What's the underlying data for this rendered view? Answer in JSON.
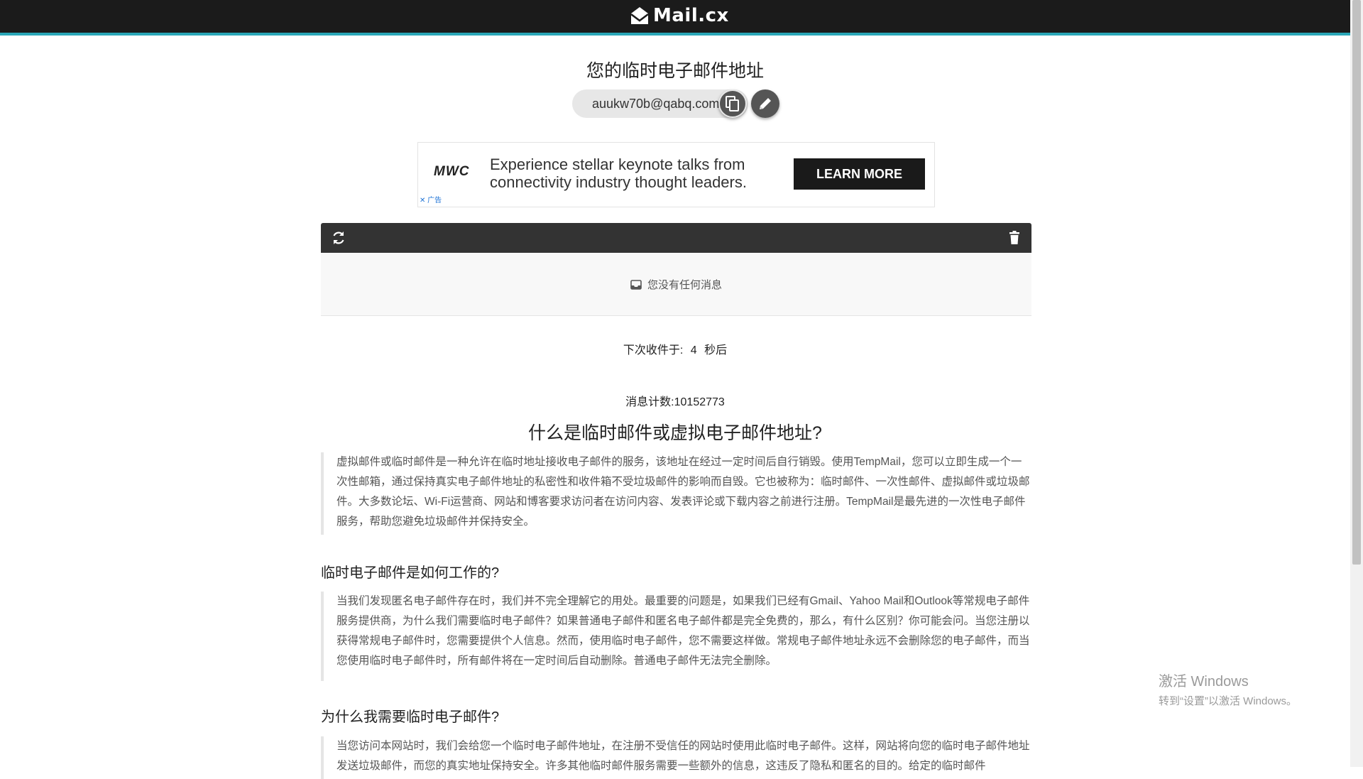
{
  "header": {
    "logo_text": "Mail.cx"
  },
  "main": {
    "title": "您的临时电子邮件地址",
    "email_address": "auukw70b@qabq.com"
  },
  "ad": {
    "brand": "MWC",
    "copy": "Experience stellar keynote talks from connectivity industry thought leaders.",
    "cta": "LEARN MORE",
    "tag": "✕ 广告"
  },
  "inbox": {
    "empty_message": "您没有任何消息",
    "countdown_prefix": "下次收件于:",
    "countdown_value": "4",
    "countdown_suffix": "秒后",
    "message_count": "消息计数:10152773"
  },
  "article": {
    "heading": "什么是临时邮件或虚拟电子邮件地址?",
    "intro": "虚拟邮件或临时邮件是一种允许在临时地址接收电子邮件的服务，该地址在经过一定时间后自行销毁。使用TempMail，您可以立即生成一个一次性邮箱，通过保持真实电子邮件地址的私密性和收件箱不受垃圾邮件的影响而自毁。它也被称为：临时邮件、一次性邮件、虚拟邮件或垃圾邮件。大多数论坛、Wi-Fi运营商、网站和博客要求访问者在访问内容、发表评论或下载内容之前进行注册。TempMail是最先进的一次性电子邮件服务，帮助您避免垃圾邮件并保持安全。",
    "section1_heading": "临时电子邮件是如何工作的?",
    "section1_body": "当我们发现匿名电子邮件存在时，我们并不完全理解它的用处。最重要的问题是，如果我们已经有Gmail、Yahoo Mail和Outlook等常规电子邮件服务提供商，为什么我们需要临时电子邮件？如果普通电子邮件和匿名电子邮件都是完全免费的，那么，有什么区别？你可能会问。当您注册以获得常规电子邮件时，您需要提供个人信息。然而，使用临时电子邮件，您不需要这样做。常规电子邮件地址永远不会删除您的电子邮件，而当您使用临时电子邮件时，所有邮件将在一定时间后自动删除。普通电子邮件无法完全删除。",
    "section2_heading": "为什么我需要临时电子邮件?",
    "section2_body": "当您访问本网站时，我们会给您一个临时电子邮件地址，在注册不受信任的网站时使用此临时电子邮件。这样，网站将向您的临时电子邮件地址发送垃圾邮件，而您的真实地址保持安全。许多其他临时邮件服务需要一些额外的信息，这违反了隐私和匿名的目的。给定的临时邮件"
  },
  "os_watermark": {
    "line1": "激活 Windows",
    "line2": "转到“设置”以激活 Windows。"
  }
}
